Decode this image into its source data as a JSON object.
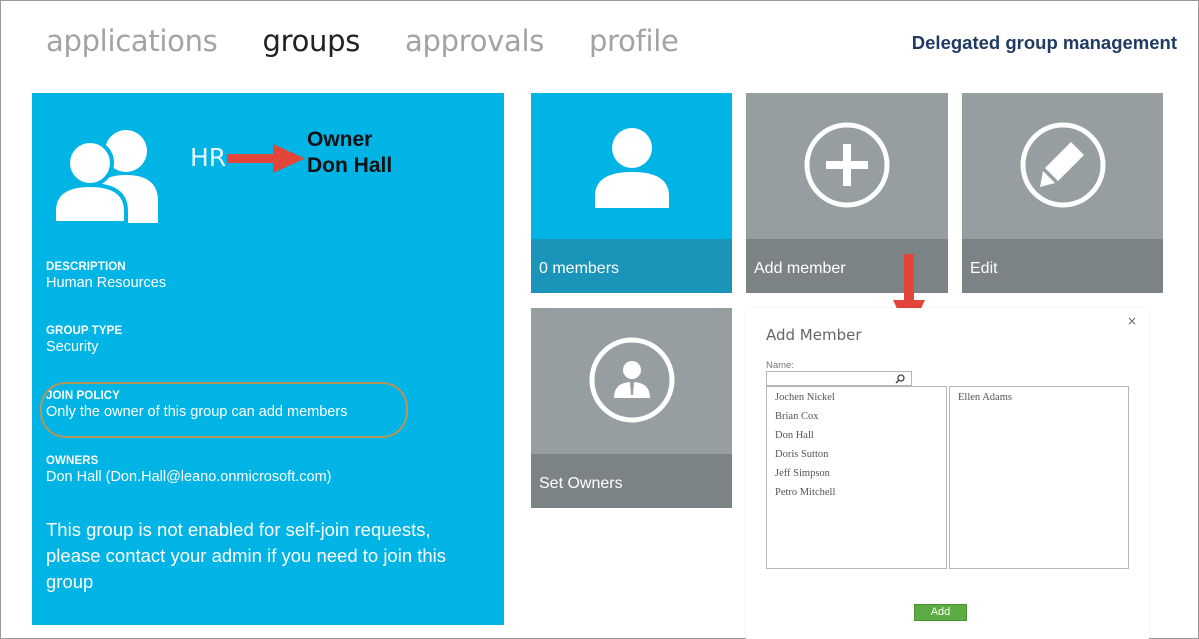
{
  "nav": {
    "tabs": [
      {
        "label": "applications",
        "active": false
      },
      {
        "label": "groups",
        "active": true
      },
      {
        "label": "approvals",
        "active": false
      },
      {
        "label": "profile",
        "active": false
      }
    ],
    "heading": "Delegated group management"
  },
  "group": {
    "name": "HR",
    "owner_annotation": [
      "Owner",
      "Don Hall"
    ],
    "description": {
      "label": "DESCRIPTION",
      "value": "Human Resources"
    },
    "group_type": {
      "label": "GROUP TYPE",
      "value": "Security"
    },
    "join_policy": {
      "label": "JOIN POLICY",
      "value": "Only the owner of this group can add members"
    },
    "owners": {
      "label": "OWNERS",
      "value": "Don Hall (Don.Hall@leano.onmicrosoft.com)"
    },
    "notice": "This group is not enabled for self-join requests, please contact your admin if you need to join this group",
    "tile_color": "#00b4e6"
  },
  "tiles": {
    "members": "0 members",
    "add_member": "Add member",
    "edit": "Edit",
    "set_owners": "Set Owners"
  },
  "dialog": {
    "title": "Add Member",
    "close": "×",
    "name_label": "Name:",
    "search_value": "",
    "available": [
      "Jochen Nickel",
      "Brian Cox",
      "Don Hall",
      "Doris Sutton",
      "Jeff Simpson",
      "Petro Mitchell"
    ],
    "selected": [
      "Ellen Adams"
    ],
    "add_button": "Add"
  },
  "colors": {
    "accent": "#00b4e6",
    "gray_tile": "#979ea2",
    "annotation_arrow": "#e2453a",
    "add_button": "#5dac43"
  }
}
